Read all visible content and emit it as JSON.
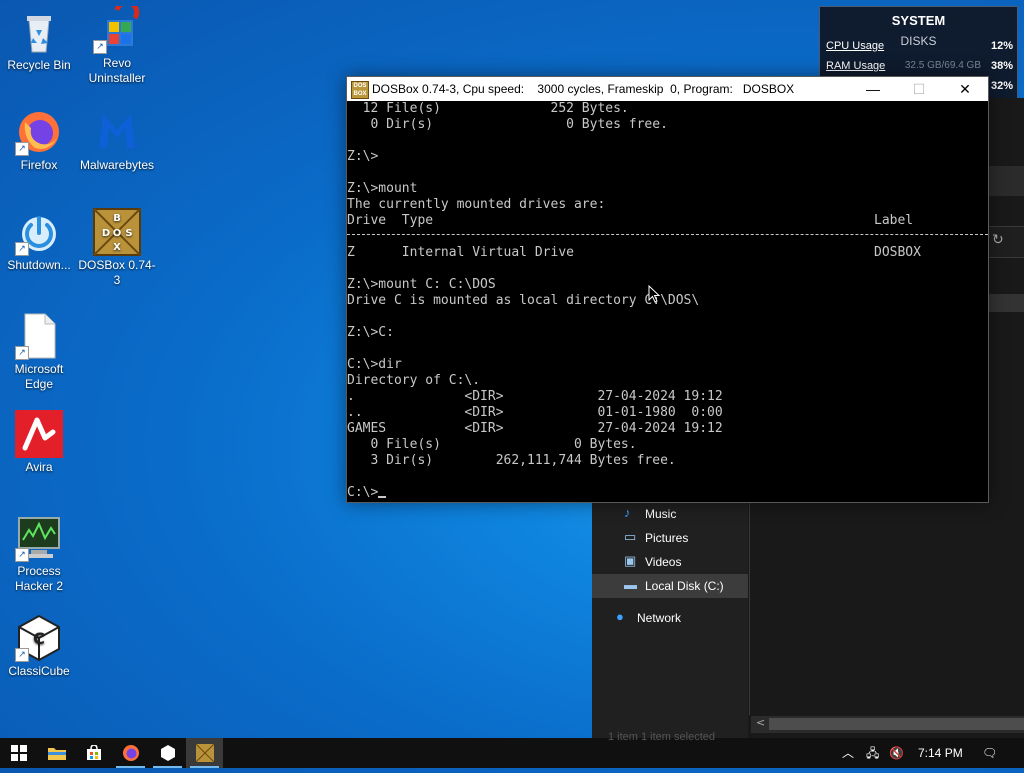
{
  "desktop": {
    "icons": [
      {
        "label": "Recycle Bin"
      },
      {
        "label": "Revo Uninstaller"
      },
      {
        "label": "Firefox"
      },
      {
        "label": "Malwarebytes"
      },
      {
        "label": "Shutdown..."
      },
      {
        "label": "DOSBox 0.74-3"
      },
      {
        "label": "Microsoft Edge"
      },
      {
        "label": "Avira"
      },
      {
        "label": "Process Hacker 2"
      },
      {
        "label": "ClassiCube"
      }
    ]
  },
  "sysmon": {
    "title": "SYSTEM",
    "subtitle": "DISKS",
    "rows": [
      {
        "label": "CPU Usage",
        "value": "",
        "percent": "12%"
      },
      {
        "label": "RAM Usage",
        "value": "32.5 GB/69.4 GB",
        "percent": "38%"
      },
      {
        "label": "",
        "value": "",
        "percent": "32%"
      }
    ]
  },
  "dosbox": {
    "title": "DOSBox 0.74-3, Cpu speed:    3000 cycles, Frameskip  0, Program:   DOSBOX",
    "app_icon": "DOS BOX",
    "controls": {
      "minimize": "—",
      "maximize": "☐",
      "close": "✕"
    },
    "lines": [
      "  12 File(s)              252 Bytes.",
      "   0 Dir(s)                 0 Bytes free.",
      "",
      "Z:\\>",
      "",
      "Z:\\>mount",
      "The currently mounted drives are:",
      "",
      "",
      "Z      Internal Virtual Drive",
      "",
      "Z:\\>mount C: C:\\DOS",
      "Drive C is mounted as local directory C:\\DOS\\",
      "",
      "Z:\\>C:",
      "",
      "C:\\>dir",
      "Directory of C:\\.",
      ".              <DIR>            27-04-2024 19:12",
      "..             <DIR>            01-01-1980  0:00",
      "GAMES          <DIR>            27-04-2024 19:12",
      "   0 File(s)                 0 Bytes.",
      "   3 Dir(s)        262,111,744 Bytes free.",
      "",
      "C:\\>"
    ],
    "table_header": {
      "left": "Drive  Type",
      "right": "Label"
    },
    "drive_label": "DOSBOX"
  },
  "explorer": {
    "nav_items": [
      {
        "label": "Music",
        "icon": "music-icon"
      },
      {
        "label": "Pictures",
        "icon": "pictures-icon"
      },
      {
        "label": "Videos",
        "icon": "videos-icon"
      },
      {
        "label": "Local Disk (C:)",
        "icon": "drive-icon",
        "selected": true
      },
      {
        "label": "Network",
        "icon": "network-icon"
      }
    ],
    "status_ghost": "1 item     1 item selected"
  },
  "taskbar": {
    "time": "7:14 PM",
    "apps": [
      "start",
      "file-explorer",
      "store",
      "firefox",
      "classicube",
      "dosbox"
    ]
  }
}
